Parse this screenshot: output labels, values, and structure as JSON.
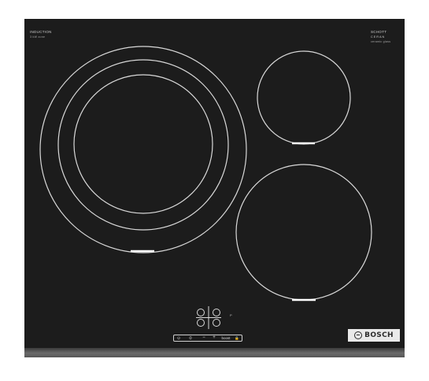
{
  "product": {
    "top_left_label": "INDUCTION",
    "top_left_sub": "3 kW zone",
    "top_right_label": "SCHOTT",
    "top_right_brand": "CERAN",
    "top_right_sub": "ceramic glass"
  },
  "controls": {
    "power_label": "⏻",
    "timer_label": "⏱",
    "minus_label": "−",
    "plus_label": "+",
    "boost_label": "boost",
    "lock_label": "🔒",
    "indicator_label": "P"
  },
  "brand": {
    "name": "BOSCH",
    "logo_icon": "bosch-armature-icon"
  },
  "colors": {
    "glass": "#1c1c1c",
    "ring": "#d9d9d9",
    "badge_bg": "#e9e9e9",
    "badge_text": "#2b2b2b"
  }
}
